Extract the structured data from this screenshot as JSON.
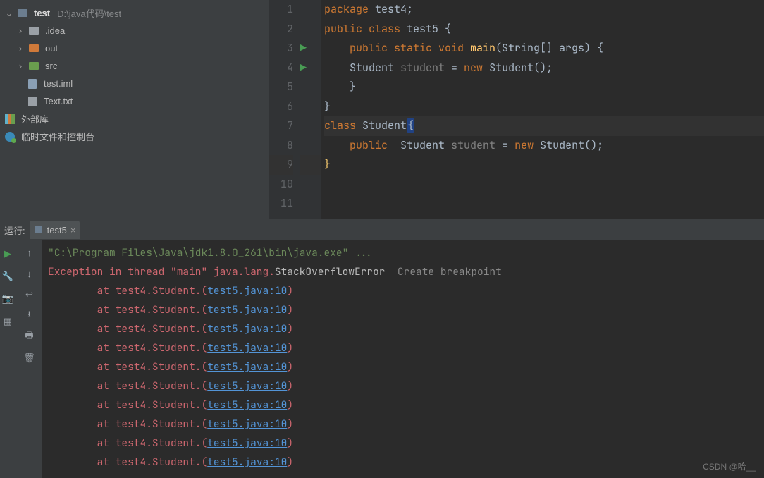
{
  "sidebar": {
    "project_name": "test",
    "project_path": "D:\\java代码\\test",
    "items": [
      {
        "label": ".idea"
      },
      {
        "label": "out"
      },
      {
        "label": "src"
      },
      {
        "label": "test.iml"
      },
      {
        "label": "Text.txt"
      }
    ],
    "external_libs": "外部库",
    "scratches": "临时文件和控制台"
  },
  "editor": {
    "lines": [
      {
        "num": "1",
        "tokens": [
          [
            "kw",
            "package "
          ],
          [
            "",
            "test4;"
          ]
        ]
      },
      {
        "num": "2",
        "tokens": [
          [
            "",
            ""
          ]
        ]
      },
      {
        "num": "3",
        "run": "▶",
        "tokens": [
          [
            "kw",
            "public class "
          ],
          [
            "",
            "test5 {"
          ]
        ]
      },
      {
        "num": "4",
        "run": "▶",
        "tokens": [
          [
            "kw",
            "    public static void "
          ],
          [
            "fn",
            "main"
          ],
          [
            "",
            "(String[] args) {"
          ]
        ]
      },
      {
        "num": "5",
        "tokens": [
          [
            "",
            "    Student "
          ],
          [
            "hint",
            "student"
          ],
          [
            "",
            " = "
          ],
          [
            "kw",
            "new "
          ],
          [
            "",
            "Student();"
          ]
        ]
      },
      {
        "num": "6",
        "tokens": [
          [
            "",
            "    }"
          ]
        ]
      },
      {
        "num": "7",
        "tokens": [
          [
            "",
            ""
          ]
        ]
      },
      {
        "num": "8",
        "tokens": [
          [
            "",
            "}"
          ]
        ]
      },
      {
        "num": "9",
        "active": true,
        "tokens": [
          [
            "kw",
            "class "
          ],
          [
            "",
            "Student"
          ],
          [
            "caret",
            "{"
          ]
        ]
      },
      {
        "num": "10",
        "tokens": [
          [
            "kw",
            "    public  "
          ],
          [
            "",
            "Student "
          ],
          [
            "hint",
            "student"
          ],
          [
            "",
            " = "
          ],
          [
            "kw",
            "new "
          ],
          [
            "",
            "Student();"
          ]
        ]
      },
      {
        "num": "11",
        "tokens": [
          [
            "br-y",
            "}"
          ]
        ]
      }
    ]
  },
  "run": {
    "label": "运行:",
    "tab": "test5",
    "cmd": "\"C:\\Program Files\\Java\\jdk1.8.0_261\\bin\\java.exe\" ...",
    "exc_prefix": "Exception in thread \"main\" java.lang.",
    "exc_class": "StackOverflowError",
    "breakpoint_hint": "Create breakpoint",
    "trace_prefix": "\tat test4.Student.<init>(",
    "trace_link": "test5.java:10",
    "trace_suffix": ")",
    "trace_count": 10
  },
  "watermark": "CSDN @哈__"
}
